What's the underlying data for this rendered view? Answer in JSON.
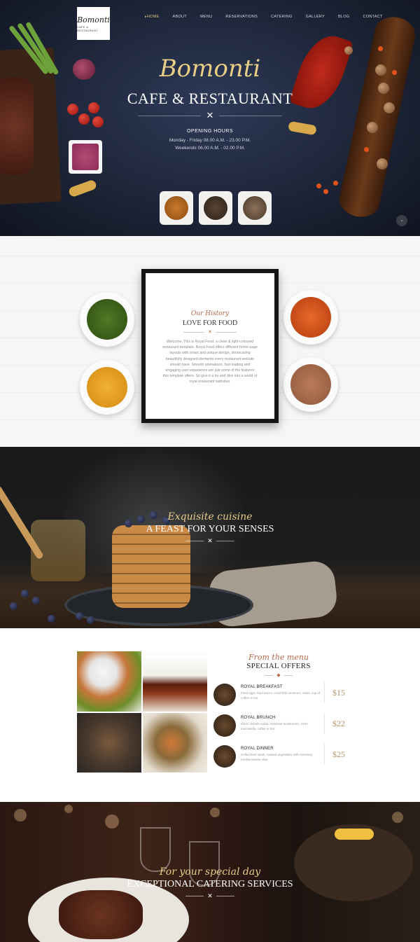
{
  "logo": {
    "main": "Bomonti",
    "sub": "CAFE & RESTAURANT"
  },
  "nav": {
    "items": [
      {
        "label": "HOME",
        "active": true
      },
      {
        "label": "ABOUT"
      },
      {
        "label": "MENU"
      },
      {
        "label": "RESERVATIONS"
      },
      {
        "label": "CATERING"
      },
      {
        "label": "GALLERY"
      },
      {
        "label": "BLOG"
      },
      {
        "label": "CONTACT"
      }
    ]
  },
  "hero": {
    "brand": "Bomonti",
    "subtitle": "CAFE & RESTAURANT",
    "hours_title": "OPENING HOURS",
    "hours_weekday": "Monday - Friday 08.00 A.M. - 23.00 P.M.",
    "hours_weekend": "Weekends 06.00 A.M. - 02.00 P.M."
  },
  "history": {
    "script": "Our History",
    "title": "LOVE FOR FOOD",
    "text": "Welcome. This is Royal Food, a clean & light-coloured restaurant template. Royal Food offers different home page layouts with smart and unique design, showcasing beautifully designed elements every restaurant website should have. Smooth animations, fast loading and engaging user experience are just some of the features this template offers. So give it a try and dive into a world of royal restaurant websites."
  },
  "feast": {
    "script": "Exquisite cuisine",
    "title": "A FEAST FOR YOUR SENSES"
  },
  "menu": {
    "script": "From the menu",
    "title": "SPECIAL OFFERS",
    "items": [
      {
        "name": "ROYAL BREAKFAST",
        "desc": "Fried eggs, fried bacon, roast field tomatoes, salad, cup of coffee or tea",
        "price": "$15"
      },
      {
        "name": "ROYAL BRUNCH",
        "desc": "Warm chicken salad, seasonal mushrooms, fresh mozzarella, coffee or tea",
        "price": "$22"
      },
      {
        "name": "ROYAL DINNER",
        "desc": "Grilled beef steak, roasted vegetables with rosemary, mediterranean olive",
        "price": "$25"
      }
    ]
  },
  "catering": {
    "script": "For your special day",
    "title": "EXCEPTIONAL CATERING SERVICES"
  },
  "colors": {
    "gold": "#e8cc86",
    "accent": "#b26a4a",
    "price": "#b58f66",
    "hero_bg": "#1d2538"
  }
}
